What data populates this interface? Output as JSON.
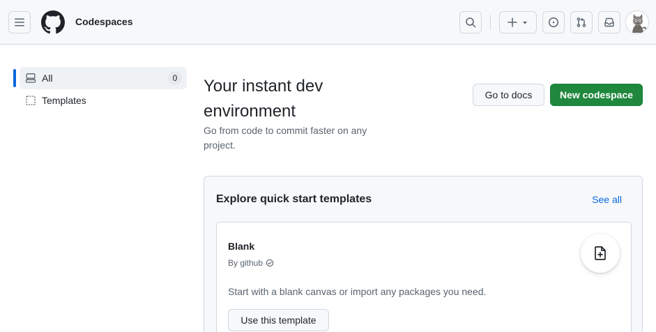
{
  "header": {
    "context_title": "Codespaces",
    "icons": [
      "menu-icon",
      "github-logo",
      "search-icon",
      "plus-icon",
      "triangle-down-icon",
      "issue-icon",
      "pull-request-icon",
      "inbox-icon"
    ]
  },
  "sidebar": {
    "items": [
      {
        "label": "All",
        "count": "0",
        "active": true,
        "icon": "server-icon"
      },
      {
        "label": "Templates",
        "active": false,
        "icon": "template-icon"
      }
    ]
  },
  "main": {
    "title": "Your instant dev environment",
    "subtitle": "Go from code to commit faster on any project.",
    "docs_button": "Go to docs",
    "new_button": "New codespace"
  },
  "templates": {
    "heading": "Explore quick start templates",
    "see_all": "See all",
    "cards": [
      {
        "name": "Blank",
        "author": "By github",
        "description": "Start with a blank canvas or import any packages you need.",
        "button": "Use this template",
        "icon": "file-added-icon"
      }
    ]
  },
  "colors": {
    "primary": "#1f883d",
    "link": "#0969da",
    "active_indicator": "#0969da"
  }
}
